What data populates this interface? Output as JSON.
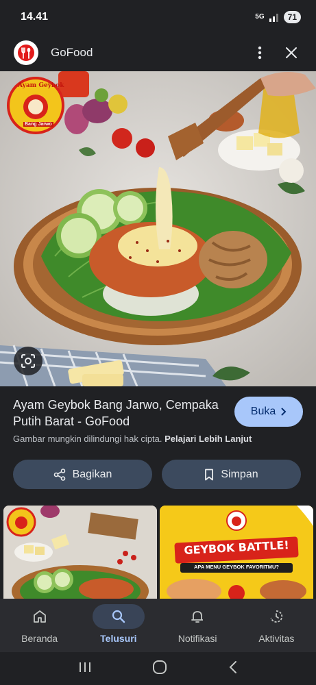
{
  "status_bar": {
    "time": "14.41",
    "network": "5G",
    "battery": "71"
  },
  "header": {
    "title": "GoFood",
    "logo_icon": "fork-spoon-icon"
  },
  "hero": {
    "logo_lines": [
      "Ayam Geybok",
      "Bang Jarwo"
    ]
  },
  "result": {
    "title": "Ayam Geybok Bang Jarwo, Cempaka Putih Barat - GoFood",
    "open_label": "Buka",
    "copyright_text": "Gambar mungkin dilindungi hak cipta.",
    "learn_more": "Pelajari Lebih Lanjut",
    "share_label": "Bagikan",
    "save_label": "Simpan"
  },
  "thumbs": {
    "second_banner": "GEYBOK BATTLE!",
    "second_subtitle": "APA MENU GEYBOK FAVORITMU?"
  },
  "bottom_nav": [
    {
      "label": "Beranda",
      "icon": "home-icon"
    },
    {
      "label": "Telusuri",
      "icon": "search-icon",
      "active": true
    },
    {
      "label": "Notifikasi",
      "icon": "bell-icon"
    },
    {
      "label": "Aktivitas",
      "icon": "activity-icon"
    }
  ],
  "colors": {
    "accent": "#a8c7fa",
    "background": "#202124",
    "brand_red": "#e21b1b"
  }
}
